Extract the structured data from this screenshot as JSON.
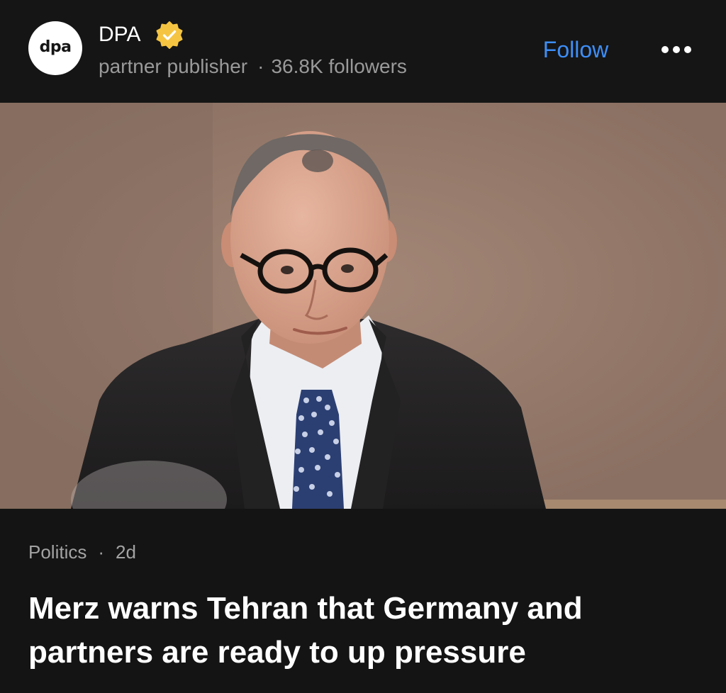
{
  "publisher": {
    "avatar_text": "dpa",
    "name": "DPA",
    "verified": true,
    "subtitle": "partner publisher",
    "followers": "36.8K followers",
    "follow_label": "Follow"
  },
  "article": {
    "category": "Politics",
    "age": "2d",
    "headline": "Merz warns Tehran that Germany and partners are ready to up pressure"
  },
  "colors": {
    "background": "#141414",
    "accent": "#3d8ef8",
    "verified_badge": "#f5c542",
    "muted_text": "#9a9a9a"
  },
  "icons": {
    "verified": "verified-check-badge-icon",
    "more": "more-horizontal-icon"
  }
}
